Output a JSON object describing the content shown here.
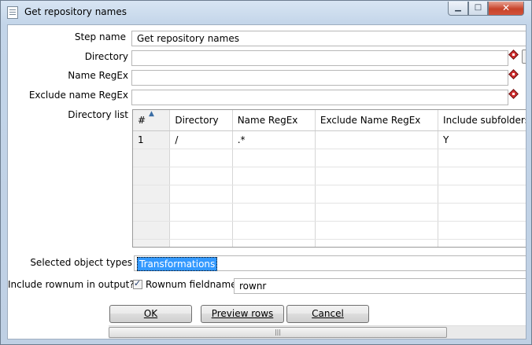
{
  "window": {
    "title": "Get repository names",
    "minimize_glyph": "▁",
    "maximize_glyph": "□",
    "close_glyph": "✕"
  },
  "form": {
    "step_name_label": "Step name",
    "step_name_value": "Get repository names",
    "directory_label": "Directory",
    "directory_value": "",
    "name_regex_label": "Name RegEx",
    "name_regex_value": "",
    "exclude_regex_label": "Exclude name RegEx",
    "exclude_regex_value": "",
    "directory_list_label": "Directory list",
    "selected_types_label": "Selected object types",
    "selected_types_value": "Transformations",
    "include_rownum_label": "Include rownum in output?",
    "rownum_checked": true,
    "rownum_fieldname_label": "Rownum fieldname",
    "rownum_fieldname_value": "rownr"
  },
  "table": {
    "columns": [
      "#",
      "Directory",
      "Name RegEx",
      "Exclude Name RegEx",
      "Include subfolders"
    ],
    "rows": [
      [
        "1",
        "/",
        ".*",
        "",
        "Y"
      ]
    ],
    "empty_rows": 6
  },
  "buttons": {
    "ok": "OK",
    "preview": "Preview rows",
    "cancel": "Cancel"
  },
  "scrollbar": {
    "grip": "|||"
  },
  "colors": {
    "selection": "#3399ff",
    "variable_icon": "#d13030"
  },
  "icons": {
    "variable": "diamond-variable-icon",
    "window": "document-icon"
  }
}
